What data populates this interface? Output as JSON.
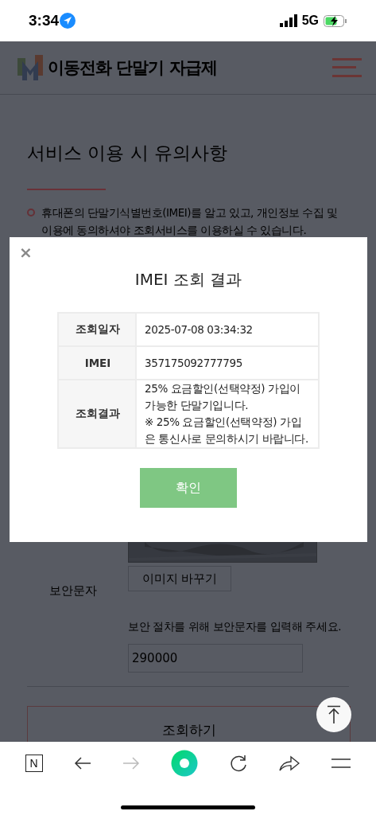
{
  "status_bar": {
    "time": "3:34",
    "network": "5G"
  },
  "header": {
    "site_title": "이동전화 단말기 자급제"
  },
  "page": {
    "heading": "서비스 이용 시 유의사항",
    "notice": "휴대폰의 단말기식별번호(IMEI)를 알고 있고, 개인정보 수집 및 이용에 동의하셔야 조회서비스를 이용하실 수 있습니다.",
    "change_image_button": "이미지 바꾸기",
    "captcha_label": "보안문자",
    "captcha_hint": "보안 절차를 위해 보안문자를 입력해 주세요.",
    "captcha_input": {
      "value": "290000"
    },
    "submit_button": "조회하기"
  },
  "dialog": {
    "close": "×",
    "title": "IMEI 조회 결과",
    "rows": [
      {
        "label": "조회일자",
        "value": "2025-07-08 03:34:32"
      },
      {
        "label": "IMEI",
        "value": "357175092777795"
      },
      {
        "label": "조회결과",
        "value": "25% 요금할인(선택약정) 가입이 가능한 단말기입니다.\n※ 25% 요금할인(선택약정) 가입은 통신사로 문의하시기 바랍니다."
      }
    ],
    "confirm_button": "확인"
  },
  "browser_toolbar": {
    "home_key": "N",
    "forward_disabled": true
  }
}
